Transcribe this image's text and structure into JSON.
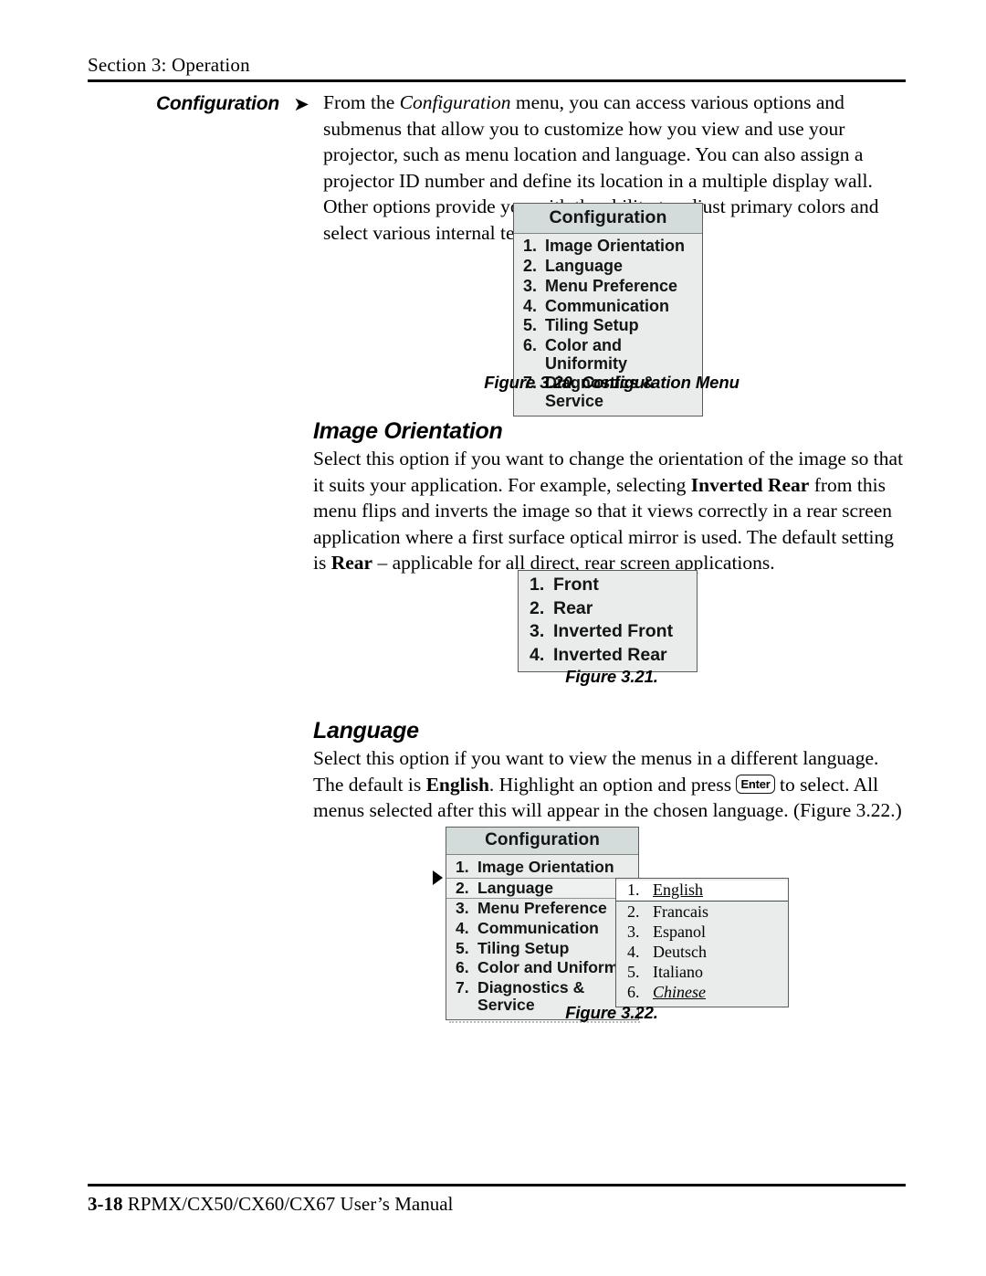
{
  "header": {
    "section_label": "Section 3: Operation"
  },
  "sidehead": {
    "label": "Configuration",
    "arrow_icon": "➤"
  },
  "intro": {
    "paragraph_part1": "From the ",
    "paragraph_italic": "Configuration",
    "paragraph_part2": " menu, you can access various options and submenus that allow you to customize how you view and use your projector, such as menu location and language. You can also assign a projector ID number and define its location in a multiple display wall. Other options provide you with the ability to adjust primary colors and select various internal test patterns."
  },
  "fig320": {
    "caption": "Figure 3.20. Configuration Menu",
    "menu_title": "Configuration",
    "items": [
      {
        "num": "1.",
        "label": "Image Orientation"
      },
      {
        "num": "2.",
        "label": "Language"
      },
      {
        "num": "3.",
        "label": "Menu Preference"
      },
      {
        "num": "4.",
        "label": "Communication"
      },
      {
        "num": "5.",
        "label": "Tiling Setup"
      },
      {
        "num": "6.",
        "label": "Color and Uniformity"
      },
      {
        "num": "7.",
        "label": "Diagnostics & Service"
      }
    ]
  },
  "image_orientation": {
    "heading": "Image Orientation",
    "p1": "Select this option if you want to change the orientation of the image so that it suits your application. For example, selecting ",
    "p_bold1": "Inverted Rear",
    "p2": " from this menu flips and inverts the image so that it views correctly in a rear screen application where a first surface optical mirror is used.   The default setting is ",
    "p_bold2": "Rear",
    "p3": " – applicable for all direct, rear screen applications."
  },
  "fig321": {
    "caption": "Figure 3.21.",
    "items": [
      {
        "num": "1.",
        "label": "Front"
      },
      {
        "num": "2.",
        "label": "Rear"
      },
      {
        "num": "3.",
        "label": "Inverted Front"
      },
      {
        "num": "4.",
        "label": "Inverted Rear"
      }
    ]
  },
  "language": {
    "heading": "Language",
    "p1": "Select this option if you want to view the menus in a different language. The default is ",
    "p_bold1": "English",
    "p2": ".  Highlight an option and press ",
    "keycap": "Enter",
    "p3": " to select. All menus selected after this will appear in the chosen language. (Figure 3.22.)"
  },
  "fig322": {
    "caption": "Figure 3.22.",
    "menu_title": "Configuration",
    "pointer_icon": "right-triangle-pointer",
    "items": [
      {
        "num": "1.",
        "label": "Image Orientation"
      },
      {
        "num": "2.",
        "label": "Language"
      },
      {
        "num": "3.",
        "label": "Menu Preference"
      },
      {
        "num": "4.",
        "label": "Communication"
      },
      {
        "num": "5.",
        "label": "Tiling Setup"
      },
      {
        "num": "6.",
        "label": "Color and Uniformity"
      },
      {
        "num": "7.",
        "label": "Diagnostics & Service"
      }
    ],
    "submenu": [
      {
        "num": "1.",
        "label": "English"
      },
      {
        "num": "2.",
        "label": "Francais"
      },
      {
        "num": "3.",
        "label": "Espanol"
      },
      {
        "num": "4.",
        "label": "Deutsch"
      },
      {
        "num": "5.",
        "label": "Italiano"
      },
      {
        "num": "6.",
        "label": "Chinese"
      }
    ]
  },
  "footer": {
    "page_number": "3-18",
    "manual_title": " RPMX/CX50/CX60/CX67 User’s Manual"
  },
  "colors": {
    "osd_body": "#e9eceb",
    "osd_title": "#d3dbdb",
    "osd_border": "#5c5c5c",
    "selected_bg": "#ffffff"
  }
}
